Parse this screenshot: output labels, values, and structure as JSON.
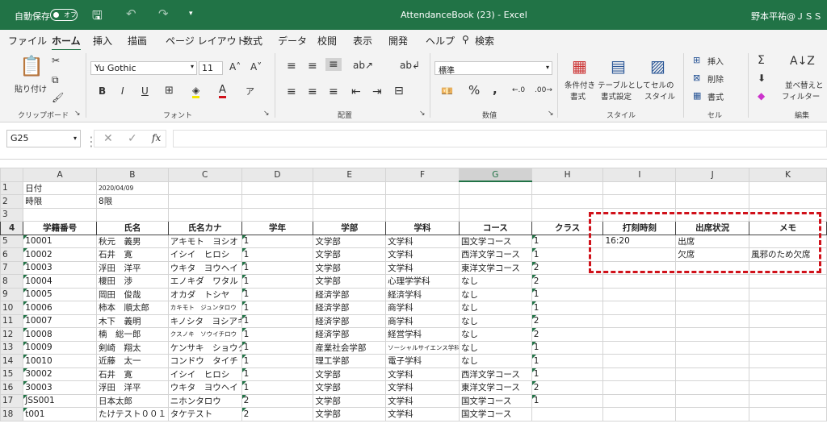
{
  "title": {
    "autosave": "自動保存",
    "toggle": "オフ",
    "filename": "AttendanceBook (23)  -  Excel",
    "user": "野本平祐@ＪＳＳ"
  },
  "tabs": [
    "ファイル",
    "ホーム",
    "挿入",
    "描画",
    "ページ レイアウト",
    "数式",
    "データ",
    "校閲",
    "表示",
    "開発",
    "ヘルプ",
    "検索"
  ],
  "ribbon": {
    "clipboard": {
      "paste": "貼り付け",
      "label": "クリップボード"
    },
    "font": {
      "name": "Yu Gothic",
      "size": "11",
      "label": "フォント",
      "bold": "B",
      "italic": "I",
      "underline": "U"
    },
    "align": {
      "label": "配置"
    },
    "number": {
      "format": "標準",
      "label": "数値",
      "percent": "%"
    },
    "style": {
      "cond": "条件付き",
      "cond2": "書式",
      "table": "テーブルとして",
      "table2": "書式設定",
      "cell": "セルの",
      "cell2": "スタイル",
      "label": "スタイル"
    },
    "cells": {
      "insert": "挿入",
      "delete": "削除",
      "format": "書式",
      "label": "セル"
    },
    "edit": {
      "sort": "並べ替えと",
      "filter": "フィルター",
      "label": "編集"
    }
  },
  "formula": {
    "cellref": "G25",
    "fx": "fx"
  },
  "columns": [
    "A",
    "B",
    "C",
    "D",
    "E",
    "F",
    "G",
    "H",
    "I",
    "J",
    "K"
  ],
  "rows": [
    [
      "1",
      "日付",
      "2020/04/09",
      "",
      "",
      "",
      "",
      "",
      "",
      "",
      "",
      ""
    ],
    [
      "2",
      "時限",
      "8限",
      "",
      "",
      "",
      "",
      "",
      "",
      "",
      "",
      ""
    ],
    [
      "3",
      "",
      "",
      "",
      "",
      "",
      "",
      "",
      "",
      "",
      "",
      ""
    ],
    [
      "4",
      "学籍番号",
      "氏名",
      "氏名カナ",
      "学年",
      "学部",
      "学科",
      "コース",
      "クラス",
      "打刻時刻",
      "出席状況",
      "メモ"
    ],
    [
      "5",
      "10001",
      "秋元　義男",
      "アキモト　ヨシオ",
      "1",
      "文学部",
      "文学科",
      "国文学コース",
      "1",
      "16:20",
      "出席",
      ""
    ],
    [
      "6",
      "10002",
      "石井　寛",
      "イシイ　ヒロシ",
      "1",
      "文学部",
      "文学科",
      "西洋文学コース",
      "1",
      "",
      "欠席",
      "風邪のため欠席"
    ],
    [
      "7",
      "10003",
      "浮田　洋平",
      "ウキタ　ヨウヘイ",
      "1",
      "文学部",
      "文学科",
      "東洋文学コース",
      "2",
      "",
      "",
      ""
    ],
    [
      "8",
      "10004",
      "榎田　渉",
      "エノキダ　ワタル",
      "1",
      "文学部",
      "心理学学科",
      "なし",
      "2",
      "",
      "",
      ""
    ],
    [
      "9",
      "10005",
      "岡田　俊哉",
      "オカダ　トシヤ",
      "1",
      "経済学部",
      "経済学科",
      "なし",
      "1",
      "",
      "",
      ""
    ],
    [
      "10",
      "10006",
      "柿本　順太郎",
      "カキモト　ジュンタロウ",
      "1",
      "経済学部",
      "商学科",
      "なし",
      "1",
      "",
      "",
      ""
    ],
    [
      "11",
      "10007",
      "木下　義明",
      "キノシタ　ヨシアキ",
      "1",
      "経済学部",
      "商学科",
      "なし",
      "2",
      "",
      "",
      ""
    ],
    [
      "12",
      "10008",
      "楠　総一郎",
      "クスノキ　ソウイチロウ",
      "1",
      "経済学部",
      "経営学科",
      "なし",
      "2",
      "",
      "",
      ""
    ],
    [
      "13",
      "10009",
      "剣崎　翔太",
      "ケンサキ　ショウタ",
      "1",
      "産業社会学部",
      "ソーシャルサイエンス学科",
      "なし",
      "1",
      "",
      "",
      ""
    ],
    [
      "14",
      "10010",
      "近藤　太一",
      "コンドウ　タイチ",
      "1",
      "理工学部",
      "電子学科",
      "なし",
      "1",
      "",
      "",
      ""
    ],
    [
      "15",
      "30002",
      "石井　寛",
      "イシイ　ヒロシ",
      "1",
      "文学部",
      "文学科",
      "西洋文学コース",
      "1",
      "",
      "",
      ""
    ],
    [
      "16",
      "30003",
      "浮田　洋平",
      "ウキタ　ヨウヘイ",
      "1",
      "文学部",
      "文学科",
      "東洋文学コース",
      "2",
      "",
      "",
      ""
    ],
    [
      "17",
      "JSS001",
      "日本太郎",
      "ニホンタロウ",
      "2",
      "文学部",
      "文学科",
      "国文学コース",
      "1",
      "",
      "",
      ""
    ],
    [
      "18",
      "t001",
      "たけテスト００１",
      "タケテスト",
      "2",
      "文学部",
      "文学科",
      "国文学コース",
      "",
      "",
      "",
      ""
    ]
  ]
}
